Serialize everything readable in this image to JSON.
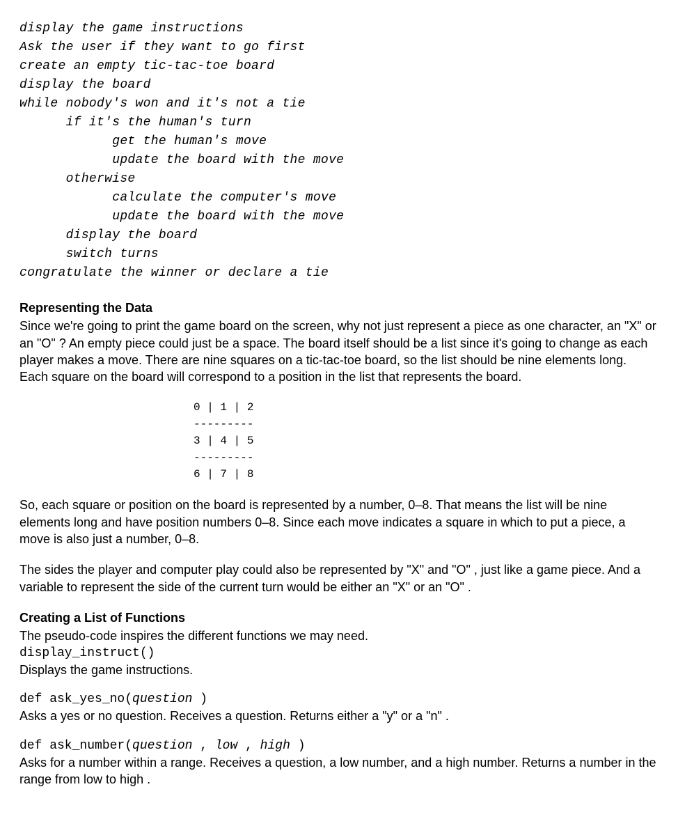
{
  "pseudo": {
    "lines": "display the game instructions\nAsk the user if they want to go first\ncreate an empty tic-tac-toe board\ndisplay the board\nwhile nobody's won and it's not a tie\n      if it's the human's turn\n            get the human's move\n            update the board with the move\n      otherwise\n            calculate the computer's move\n            update the board with the move\n      display the board\n      switch turns\ncongratulate the winner or declare a tie"
  },
  "section1": {
    "heading": "Representing the Data",
    "para1": "Since we're going to print the game board on the screen, why not just represent a piece as one character, an \"X\" or an \"O\" ? An empty piece could just be a space. The board itself should be a list since it's going to change as each player makes a move. There are nine squares on a tic-tac-toe board, so the list should be nine elements long. Each square on the board will correspond to a position in the list that represents the board.",
    "board": "0 | 1 | 2\n---------\n3 | 4 | 5\n---------\n6 | 7 | 8",
    "para2": "So, each square or position on the board is represented by a number, 0–8. That means the list will be nine elements long and have position numbers 0–8. Since each move indicates a square in which to put a piece, a move is also just a number, 0–8.",
    "para3": "The sides the player and computer play could also be represented by \"X\" and \"O\" , just like a game piece. And a variable to represent the side of the current turn would be either an \"X\" or an \"O\" ."
  },
  "section2": {
    "heading": "Creating a List of Functions",
    "intro": "The pseudo-code inspires the different functions we may need.",
    "f1": {
      "sig": "display_instruct()",
      "desc": "Displays the game instructions."
    },
    "f2": {
      "sig_pre": "def ask_yes_no(",
      "param1": "question",
      "sig_post": " )",
      "desc": "Asks a yes or no question. Receives a question. Returns either a \"y\" or a \"n\" ."
    },
    "f3": {
      "sig_pre": "def ask_number(",
      "param1": "question",
      "sep1": " , ",
      "param2": "low",
      "sep2": " , ",
      "param3": "high",
      "sig_post": " )",
      "desc": "Asks for a number within a range. Receives a question, a low number, and a high number. Returns a number in the range from low to high ."
    }
  }
}
